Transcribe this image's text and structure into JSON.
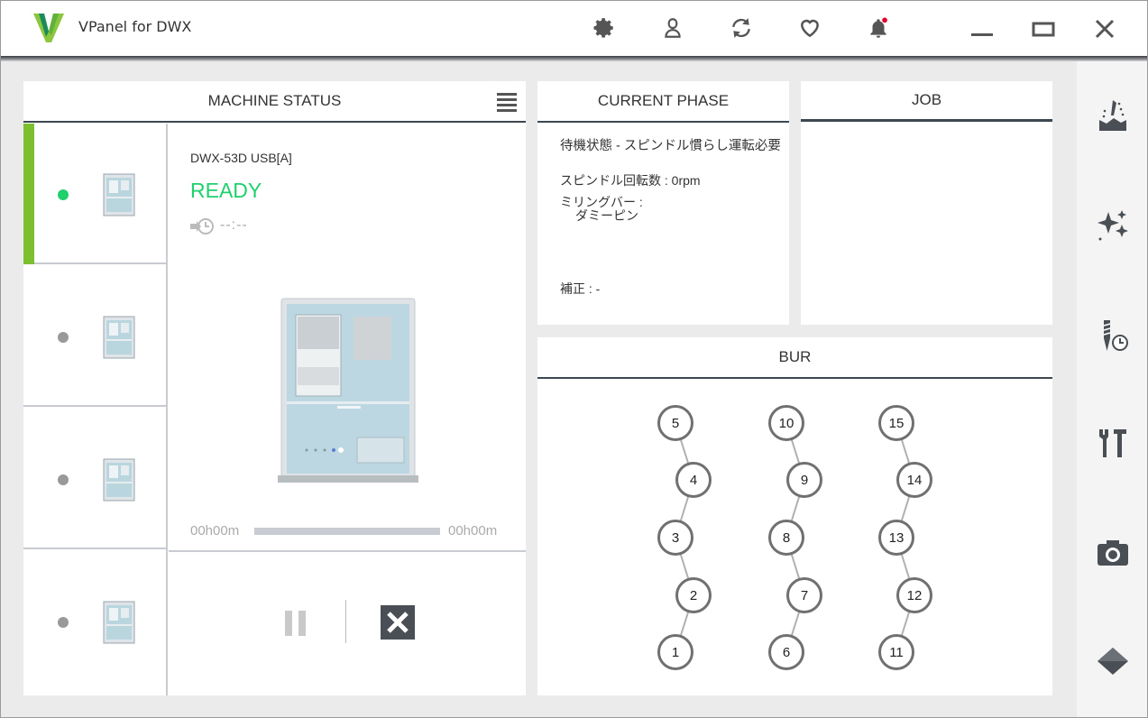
{
  "app": {
    "title": "VPanel for DWX"
  },
  "toolbar": {
    "icons": [
      "gear-icon",
      "user-icon",
      "refresh-icon",
      "heart-icon",
      "bell-icon"
    ],
    "notification_dot_color": "#e4002b"
  },
  "window_controls": [
    "minimize",
    "maximize",
    "close"
  ],
  "colors": {
    "accent_green": "#7cbf2f",
    "ready_green": "#20d06e",
    "header_rule": "#3d4750"
  },
  "machine_status": {
    "title": "MACHINE STATUS",
    "machines": [
      {
        "state": "active"
      },
      {
        "state": "idle"
      },
      {
        "state": "idle"
      },
      {
        "state": "idle"
      }
    ],
    "selected": {
      "name": "DWX-53D USB[A]",
      "status": "READY",
      "eta": "--:--",
      "elapsed": "00h00m",
      "remaining": "00h00m",
      "progress": 0
    }
  },
  "current_phase": {
    "title": "CURRENT PHASE",
    "state": "待機状態 - スピンドル慣らし運転必要",
    "spindle": "スピンドル回転数 : 0rpm",
    "milling_bur_label": "ミリングバー :",
    "milling_bur_value": "ダミーピン",
    "correction": "補正 : -"
  },
  "job": {
    "title": "JOB"
  },
  "bur": {
    "title": "BUR",
    "columns": [
      [
        "5",
        "4",
        "3",
        "2",
        "1"
      ],
      [
        "10",
        "9",
        "8",
        "7",
        "6"
      ],
      [
        "15",
        "14",
        "13",
        "12",
        "11"
      ]
    ]
  },
  "sidebar": [
    "milling-icon",
    "sparkle-icon",
    "bur-time-icon",
    "tools-icon",
    "camera-icon",
    "diamond-icon"
  ]
}
